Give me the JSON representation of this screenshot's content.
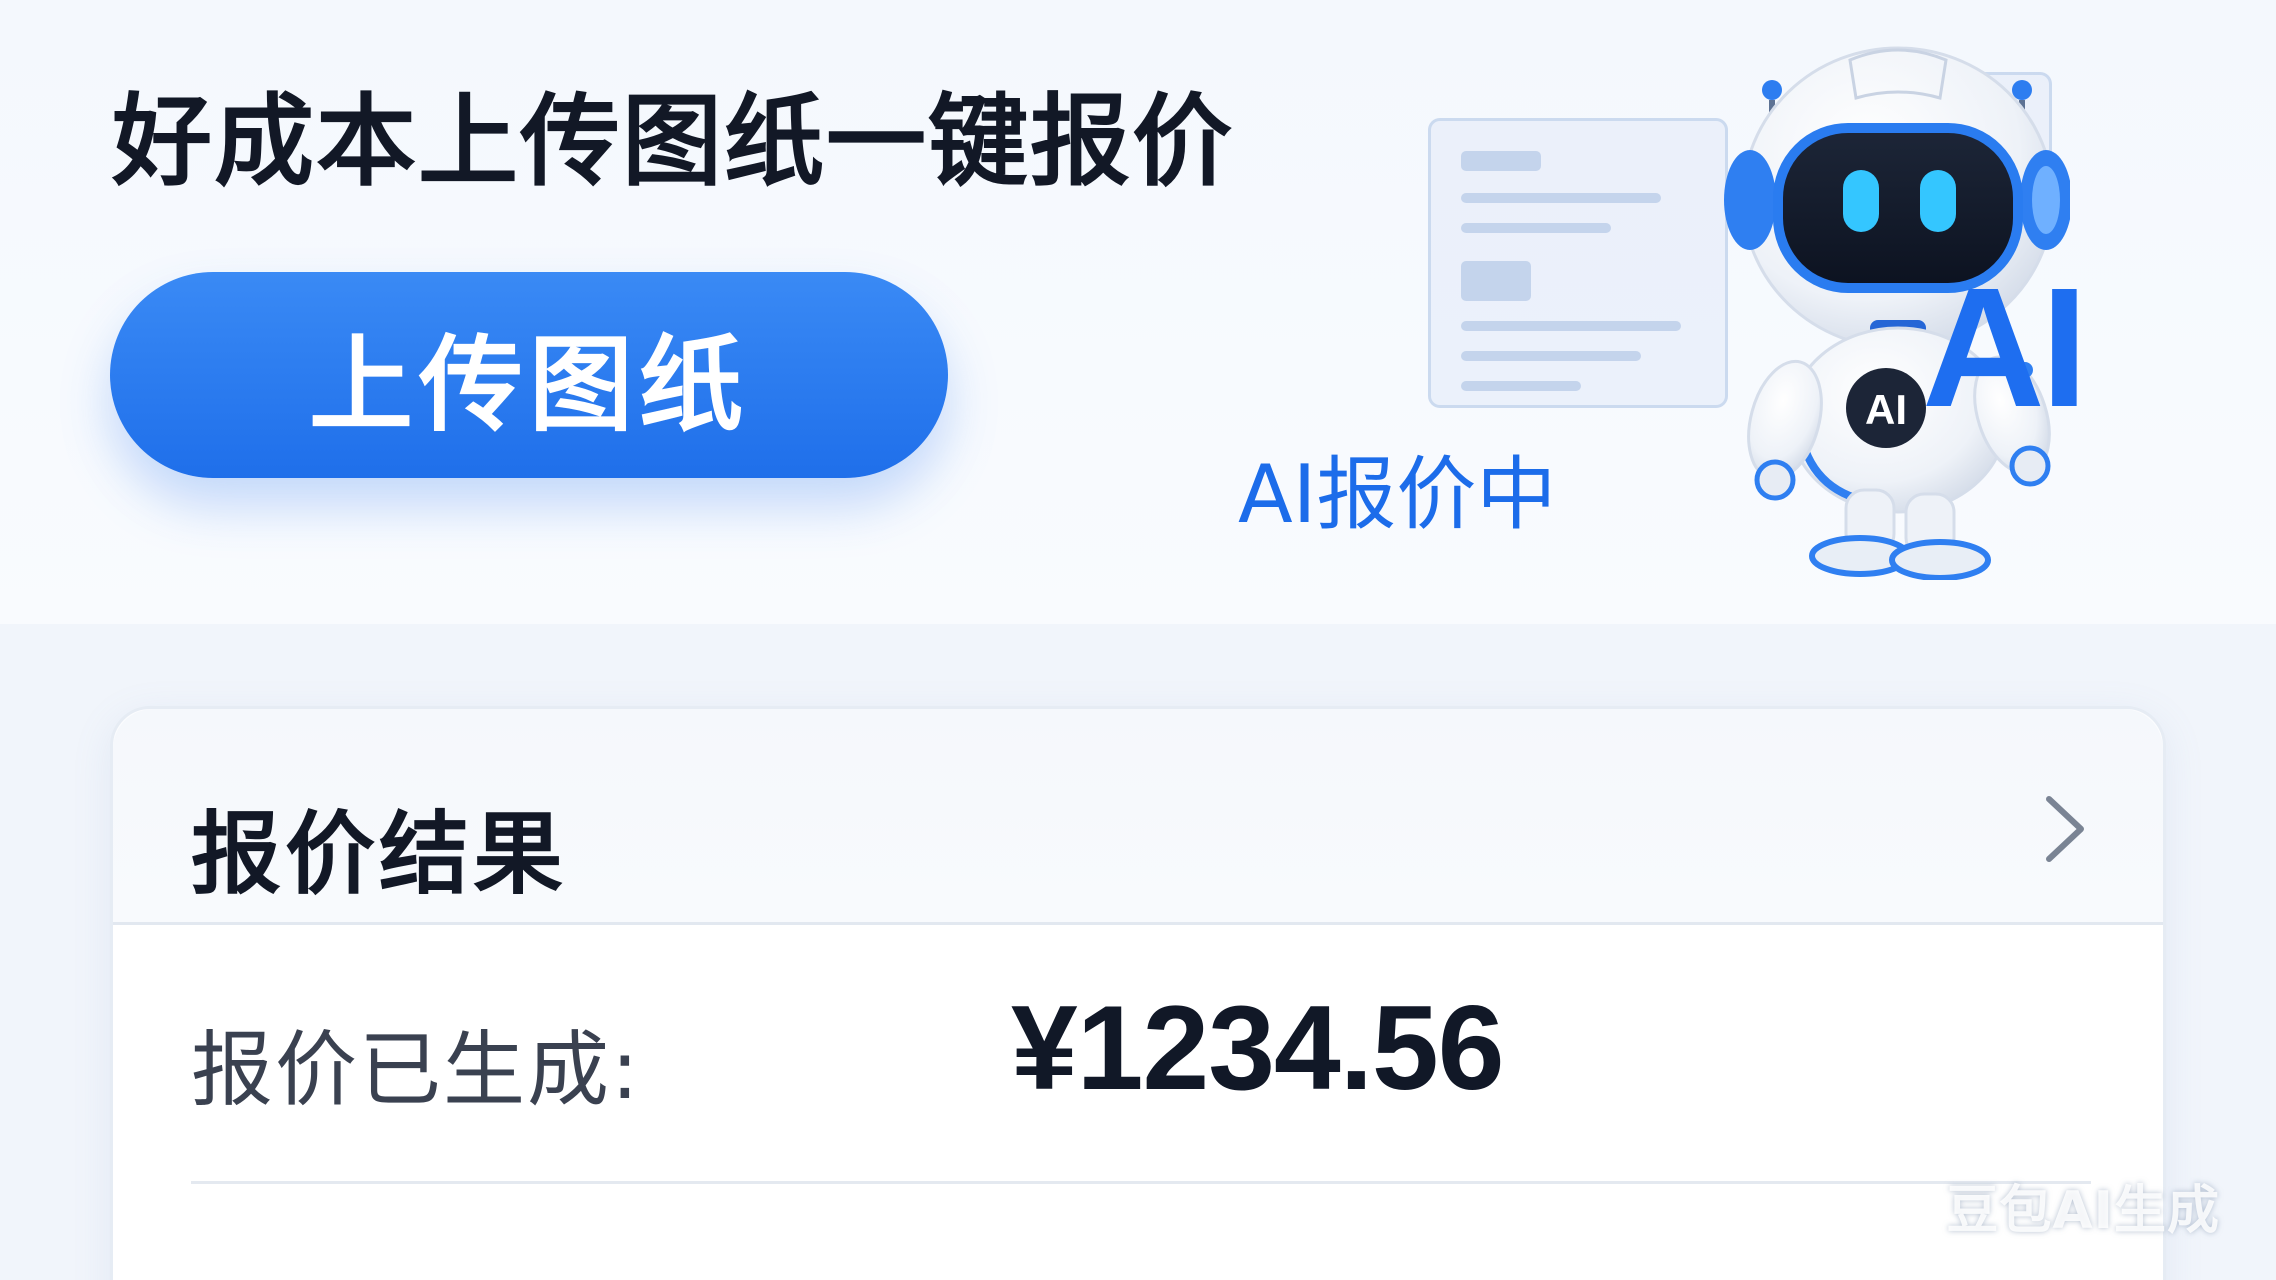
{
  "hero": {
    "headline": "好成本上传图纸一键报价",
    "upload_button": "上传图纸",
    "illustration": {
      "ai_large": "AI",
      "status_text": "AI报价中",
      "chest_badge": "AI",
      "icon": "ai-robot-icon"
    }
  },
  "result": {
    "title": "报价结果",
    "chevron_icon": "chevron-right-icon",
    "quote_label": "报价已生成:",
    "quote_value": "¥1234.56"
  },
  "watermark": "豆包AI生成",
  "colors": {
    "accent": "#1f6fea",
    "title_text": "#121826",
    "background": "#f1f5fb"
  }
}
